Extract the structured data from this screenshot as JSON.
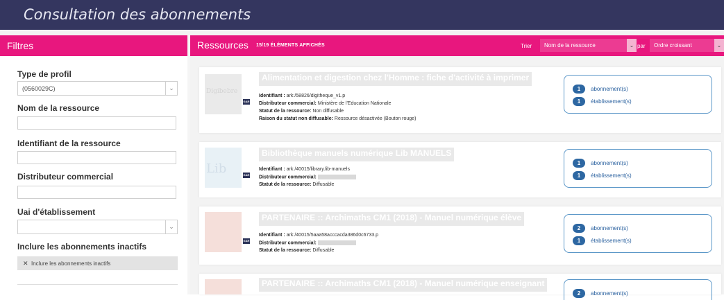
{
  "app": {
    "title": "Consultation des abonnements"
  },
  "filters": {
    "header": "Filtres",
    "type_profil_label": "Type de profil",
    "type_profil_value": "(0560029C)",
    "nom_label": "Nom de la ressource",
    "identifiant_label": "Identifiant de la ressource",
    "distributeur_label": "Distributeur commercial",
    "uai_label": "Uai d'établissement",
    "inactifs_label": "Inclure les abonnements inactifs",
    "inactifs_tag": "Inclure les abonnements inactifs"
  },
  "results": {
    "header": "Ressources",
    "count": "15/19 ÉLÉMENTS AFFICHÉS",
    "trier_label": "Trier",
    "sort_field": "Nom de la ressource",
    "par_label": "par",
    "sort_order": "Ordre croissant",
    "gar_badge": "GAR",
    "id_key": "Identifiant :",
    "dist_key": "Distributeur commercial:",
    "statut_key": "Statut de la ressource:",
    "raison_key": "Raison du statut non diffusable:",
    "abonnement_label": "abonnement(s)",
    "etablissement_label": "établissement(s)",
    "cards": [
      {
        "title": "Alimentation et digestion chez l'Homme : fiche d'activité à imprimer",
        "thumb_text": "Digibebre",
        "identifiant": "ark:/58826/digitheque_v1.p",
        "distributeur": "Ministère de l'Education Nationale",
        "statut": "Non diffusable",
        "raison": "Ressource désactivée (Bouton rouge)",
        "abonnements": "1",
        "etablissements": "1"
      },
      {
        "title": "Bibliothèque manuels numérique Lib MANUELS",
        "thumb_text": "Lib",
        "identifiant": "ark:/40015/library.lib-manuels",
        "statut": "Diffusable",
        "abonnements": "1",
        "etablissements": "1"
      },
      {
        "title": "PARTENAIRE :: Archimaths CM1 (2018) - Manuel numérique élève",
        "identifiant": "ark:/40015/5aaa58acccacda386d0c6733.p",
        "statut": "Diffusable",
        "abonnements": "2",
        "etablissements": "1"
      },
      {
        "title": "PARTENAIRE :: Archimaths CM1 (2018) - Manuel numérique enseignant",
        "abonnements": "2"
      }
    ]
  },
  "colors": {
    "header_bg": "#34365f",
    "accent": "#e8177e",
    "badge": "#2d67a2"
  }
}
